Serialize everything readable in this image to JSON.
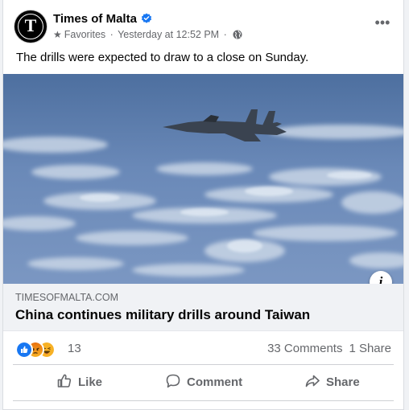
{
  "post": {
    "page_name": "Times of Malta",
    "avatar_letter": "T",
    "audience": "Favorites",
    "separator": "·",
    "timestamp": "Yesterday at 12:52 PM",
    "caption": "The drills were expected to draw to a close on Sunday.",
    "more_menu": "•••"
  },
  "link_preview": {
    "domain": "TIMESOFMALTA.COM",
    "title": "China continues military drills around Taiwan",
    "info": "i"
  },
  "stats": {
    "reaction_count": "13",
    "comments": "33 Comments",
    "shares": "1 Share"
  },
  "actions": {
    "like": "Like",
    "comment": "Comment",
    "share": "Share"
  },
  "colors": {
    "like_blue": "#1877f2",
    "love_red": "#f33e58",
    "haha_yellow": "#f7b125",
    "verified_blue": "#1877f2",
    "sky": "#5d7fb2"
  },
  "icons": [
    "star-icon",
    "globe-icon",
    "verified-badge-icon",
    "more-icon",
    "info-icon",
    "like-reaction-icon",
    "angry-reaction-icon",
    "haha-reaction-icon",
    "thumbs-up-icon",
    "comment-icon",
    "share-icon"
  ]
}
